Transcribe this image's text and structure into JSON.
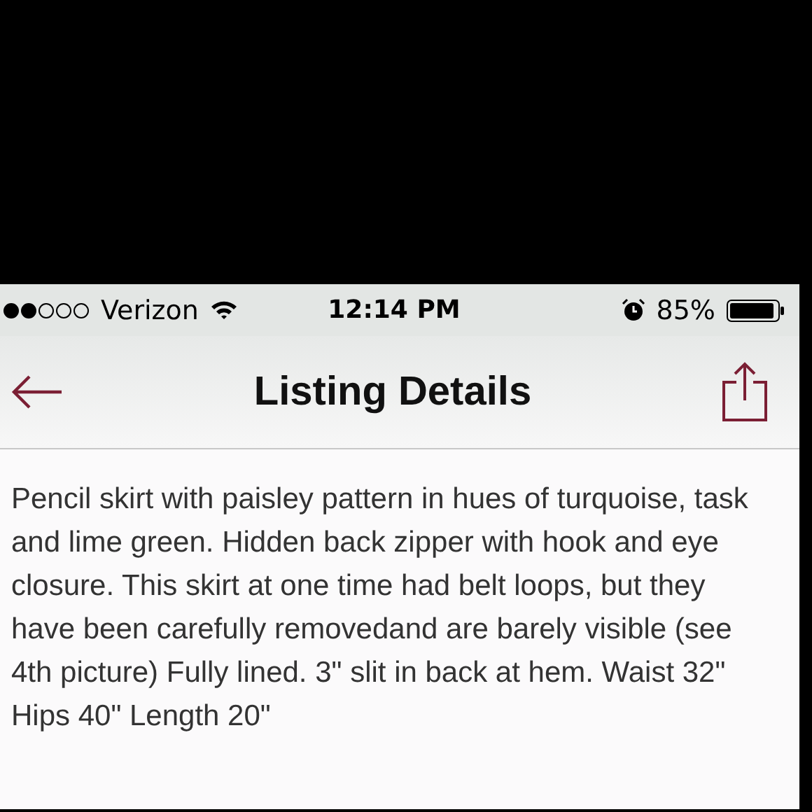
{
  "status_bar": {
    "carrier": "Verizon",
    "time": "12:14 PM",
    "battery_percent": "85%"
  },
  "nav_bar": {
    "title": "Listing Details"
  },
  "description": "Pencil skirt with paisley pattern in hues of turquoise, task and lime green. Hidden back zipper with hook and eye closure. This skirt at one time had belt loops, but they have been carefully removedand are barely visible (see 4th picture) Fully lined. 3\" slit in back at hem. Waist 32\" Hips 40\" Length 20\""
}
